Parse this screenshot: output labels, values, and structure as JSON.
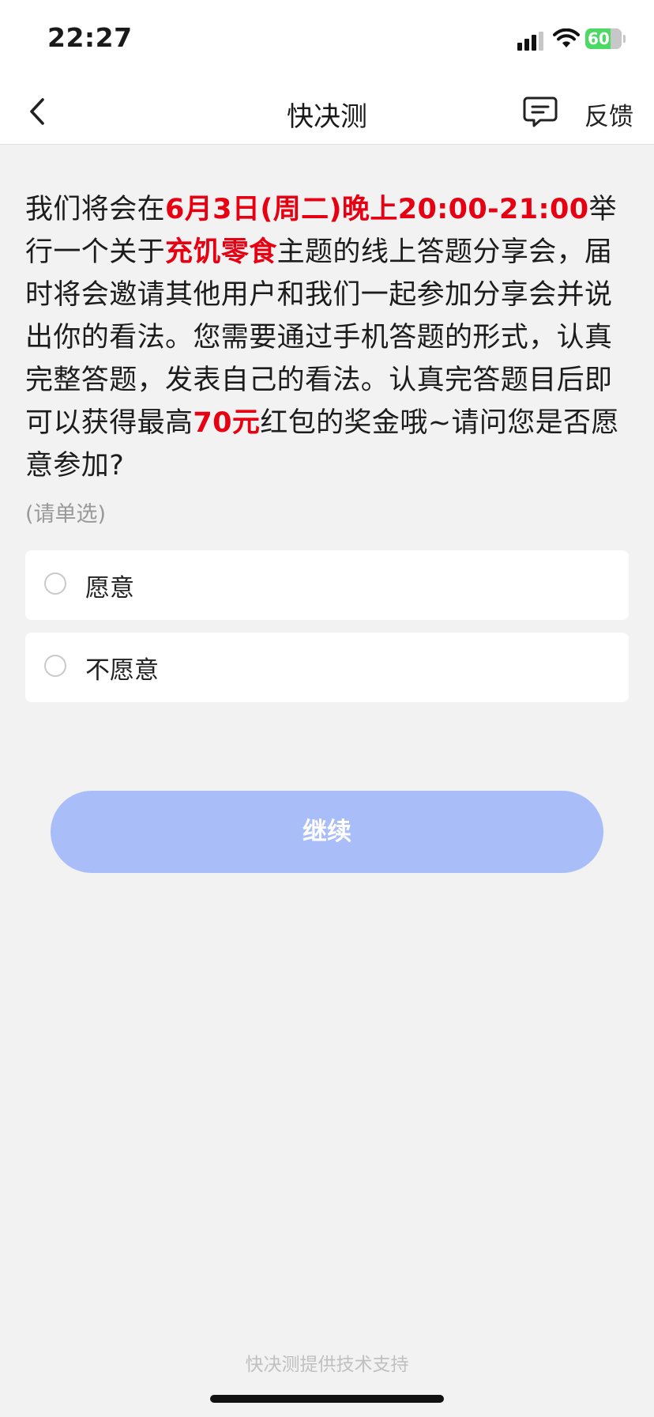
{
  "status_bar": {
    "time": "22:27",
    "battery_percent": "60",
    "battery_color": "#4cd964"
  },
  "nav": {
    "title": "快决测",
    "back_icon": "chevron-left-icon",
    "feedback_icon": "message-icon",
    "feedback_label": "反馈"
  },
  "question": {
    "segments": [
      {
        "text": "我们将会在",
        "highlight": false
      },
      {
        "text": "6月3日(周二)晚上20:00-21:00",
        "highlight": true
      },
      {
        "text": "举行一个关于",
        "highlight": false
      },
      {
        "text": "充饥零食",
        "highlight": true
      },
      {
        "text": "主题的线上答题分享会，届时将会邀请其他用户和我们一起参加分享会并说出你的看法。您需要通过手机答题的形式，认真完整答题，发表自己的看法。认真完答题目后即可以获得最高",
        "highlight": false
      },
      {
        "text": "70元",
        "highlight": true
      },
      {
        "text": "红包的奖金哦~请问您是否愿意参加?",
        "highlight": false
      }
    ],
    "hint": "(请单选)",
    "highlight_color": "#e60012"
  },
  "options": [
    {
      "label": "愿意",
      "selected": false
    },
    {
      "label": "不愿意",
      "selected": false
    }
  ],
  "continue_button": {
    "label": "继续",
    "enabled": false,
    "color": "#a9bdf8"
  },
  "footer": {
    "text": "快决测提供技术支持"
  }
}
